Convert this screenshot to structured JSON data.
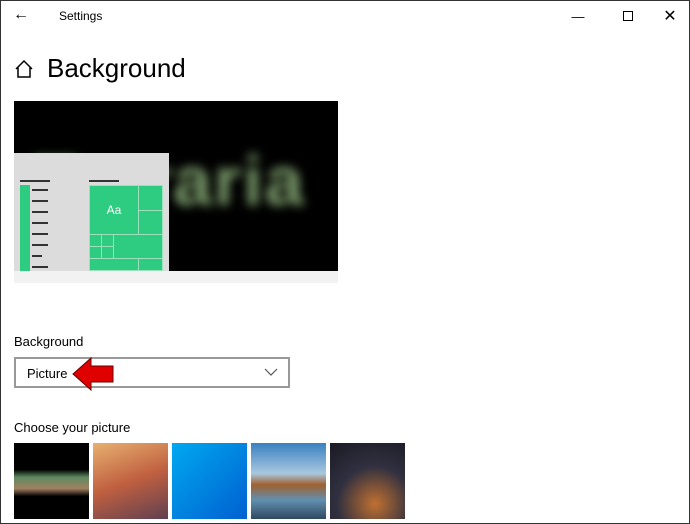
{
  "window": {
    "title": "Settings",
    "back_icon": "arrow-left-icon",
    "controls": [
      "minimize",
      "maximize",
      "close"
    ]
  },
  "page": {
    "title": "Background",
    "icon": "home-icon"
  },
  "preview": {
    "sample_text": "Aa"
  },
  "background_section": {
    "label": "Background",
    "selected": "Picture"
  },
  "picture_section": {
    "label": "Choose your picture",
    "thumbnails": [
      "terraria",
      "anime-sunset",
      "windows-blue",
      "beach-rocks",
      "night-sky-tent"
    ]
  },
  "colors": {
    "accent": "#2ecc80",
    "annotation_arrow": "#e00000"
  }
}
